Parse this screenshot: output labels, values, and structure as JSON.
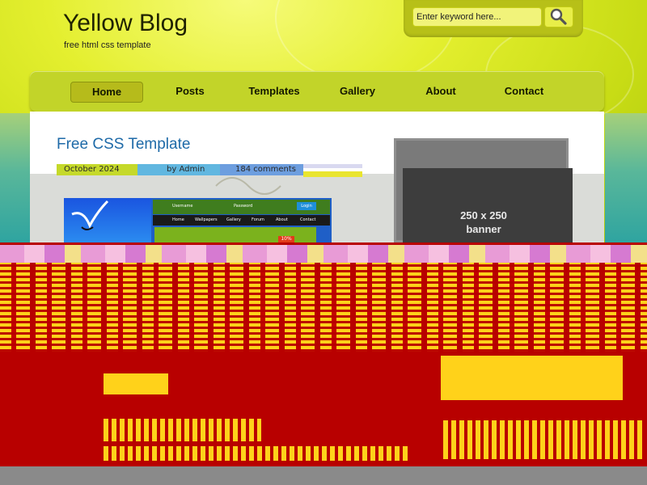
{
  "header": {
    "site_title": "Yellow Blog",
    "site_subtitle": "free html css template"
  },
  "search": {
    "placeholder": "Enter keyword here...",
    "button_icon": "magnifier-icon"
  },
  "nav": {
    "items": [
      {
        "label": "Home",
        "active": true
      },
      {
        "label": "Posts",
        "active": false
      },
      {
        "label": "Templates",
        "active": false
      },
      {
        "label": "Gallery",
        "active": false
      },
      {
        "label": "About",
        "active": false
      },
      {
        "label": "Contact",
        "active": false
      }
    ]
  },
  "post": {
    "title": "Free CSS Template",
    "date": "October 2024",
    "author": "by Admin",
    "comments": "184 comments",
    "thumbnail": {
      "nav_items": [
        "Home",
        "Wallpapers",
        "Gallery",
        "Forum",
        "About",
        "Contact"
      ],
      "field_labels": [
        "Username",
        "Password"
      ],
      "button": "Login",
      "badge": "10%"
    }
  },
  "sidebar": {
    "banner_size": "250 x 250",
    "banner_label": "banner"
  },
  "colors": {
    "accent_yellow": "#d4e321",
    "title_blue": "#1e6aa8",
    "corrupt_red": "#b80000",
    "corrupt_yellow": "#ffd21a"
  }
}
